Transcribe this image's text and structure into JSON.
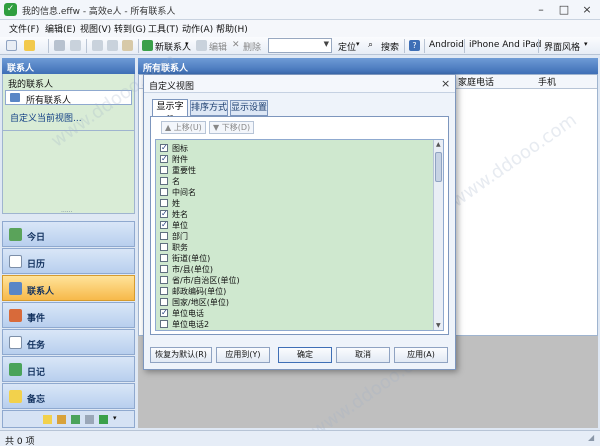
{
  "window": {
    "title": "我的信息.effw - 高效e人 - 所有联系人"
  },
  "menu": [
    "文件(F)",
    "编辑(E)",
    "视图(V)",
    "转到(G)",
    "工具(T)",
    "动作(A)",
    "帮助(H)"
  ],
  "toolbar": {
    "new_contact": "新联系人",
    "edit": "编辑",
    "delete": "删除",
    "locate": "定位",
    "search": "搜索",
    "android": "Android",
    "iphone": "iPhone And iPad",
    "style": "界面风格"
  },
  "left": {
    "header": "联系人",
    "section": "我的联系人",
    "all_contacts": "所有联系人",
    "customize": "自定义当前视图...",
    "nav": [
      "今日",
      "日历",
      "联系人",
      "事件",
      "任务",
      "日记",
      "备忘"
    ]
  },
  "right": {
    "header": "所有联系人",
    "cols": [
      "家庭电话",
      "手机"
    ]
  },
  "dialog": {
    "title": "自定义视图",
    "tabs": [
      "显示字段",
      "排序方式",
      "显示设置"
    ],
    "move_up": "上移(U)",
    "move_down": "下移(D)",
    "fields": [
      {
        "label": "图标",
        "checked": true
      },
      {
        "label": "附件",
        "checked": true
      },
      {
        "label": "重要性",
        "checked": false
      },
      {
        "label": "名",
        "checked": false
      },
      {
        "label": "中间名",
        "checked": false
      },
      {
        "label": "姓",
        "checked": false
      },
      {
        "label": "姓名",
        "checked": true
      },
      {
        "label": "单位",
        "checked": true
      },
      {
        "label": "部门",
        "checked": false
      },
      {
        "label": "职务",
        "checked": false
      },
      {
        "label": "街道(单位)",
        "checked": false
      },
      {
        "label": "市/县(单位)",
        "checked": false
      },
      {
        "label": "省/市/自治区(单位)",
        "checked": false
      },
      {
        "label": "邮政编码(单位)",
        "checked": false
      },
      {
        "label": "国家/地区(单位)",
        "checked": false
      },
      {
        "label": "单位电话",
        "checked": true
      },
      {
        "label": "单位电话2",
        "checked": false
      }
    ],
    "buttons": {
      "reset": "恢复为默认(R)",
      "apply_to": "应用到(Y)",
      "ok": "确定",
      "cancel": "取消",
      "apply": "应用(A)"
    }
  },
  "status": {
    "text": "共 0 项"
  },
  "colors": {
    "accent": "#3e6fb6",
    "active_nav": "#f7b94a",
    "list_bg": "#cfe8cf"
  }
}
